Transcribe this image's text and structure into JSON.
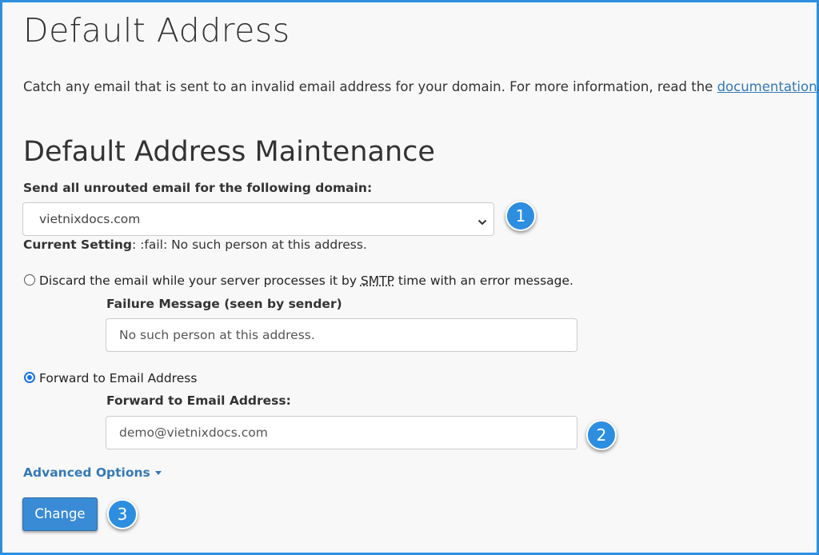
{
  "page": {
    "title": "Default Address",
    "description_prefix": "Catch any email that is sent to an invalid email address for your domain. For more information, read the ",
    "description_link": "documentation",
    "description_suffix": "."
  },
  "section": {
    "title": "Default Address Maintenance",
    "domain_label": "Send all unrouted email for the following domain:",
    "domain_value": "vietnixdocs.com",
    "current_setting_label": "Current Setting",
    "current_setting_value": ": :fail: No such person at this address."
  },
  "option_discard": {
    "label_prefix": "Discard the email while your server processes it by ",
    "label_abbr": "SMTP",
    "label_suffix": " time with an error message.",
    "checked": false,
    "field_label": "Failure Message (seen by sender)",
    "field_value": "No such person at this address."
  },
  "option_forward": {
    "label": "Forward to Email Address",
    "checked": true,
    "field_label": "Forward to Email Address:",
    "field_value": "demo@vietnixdocs.com"
  },
  "advanced_options": "Advanced Options",
  "change_button": "Change",
  "badges": [
    "1",
    "2",
    "3"
  ],
  "icons": {
    "select": "chevron-down-icon",
    "advanced": "caret-down-icon"
  },
  "colors": {
    "accent": "#337ab7",
    "badge": "#2d8ee0",
    "button": "#3a8bd5",
    "frame": "#2f8fde"
  }
}
